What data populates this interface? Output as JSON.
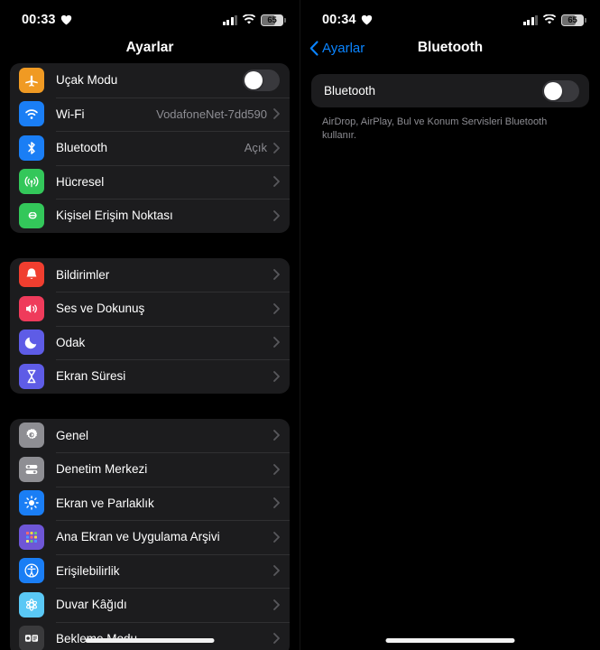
{
  "left_panel": {
    "status_bar": {
      "time": "00:33",
      "heart_icon": "heart-icon",
      "signal_icon": "cellular-signal-icon",
      "wifi_icon": "wifi-icon",
      "battery_percent": "65"
    },
    "nav": {
      "title": "Ayarlar"
    },
    "groups": [
      {
        "rows": [
          {
            "label": "Uçak Modu",
            "value": "",
            "icon": "airplane-icon",
            "icon_color": "#f09a23",
            "control": "toggle",
            "toggle_on": false
          },
          {
            "label": "Wi-Fi",
            "value": "VodafoneNet-7dd590",
            "icon": "wifi-icon",
            "icon_color": "#1a7ef5",
            "control": "chevron"
          },
          {
            "label": "Bluetooth",
            "value": "Açık",
            "icon": "bluetooth-icon",
            "icon_color": "#1a7ef5",
            "control": "chevron"
          },
          {
            "label": "Hücresel",
            "value": "",
            "icon": "cellular-icon",
            "icon_color": "#33c75a",
            "control": "chevron"
          },
          {
            "label": "Kişisel Erişim Noktası",
            "value": "",
            "icon": "hotspot-icon",
            "icon_color": "#33c75a",
            "control": "chevron"
          }
        ]
      },
      {
        "rows": [
          {
            "label": "Bildirimler",
            "value": "",
            "icon": "bell-icon",
            "icon_color": "#f03e2f",
            "control": "chevron"
          },
          {
            "label": "Ses ve Dokunuş",
            "value": "",
            "icon": "speaker-icon",
            "icon_color": "#ef3b5b",
            "control": "chevron"
          },
          {
            "label": "Odak",
            "value": "",
            "icon": "moon-icon",
            "icon_color": "#5e5ce6",
            "control": "chevron"
          },
          {
            "label": "Ekran Süresi",
            "value": "",
            "icon": "hourglass-icon",
            "icon_color": "#5e5ce6",
            "control": "chevron"
          }
        ]
      },
      {
        "rows": [
          {
            "label": "Genel",
            "value": "",
            "icon": "gear-icon",
            "icon_color": "#8e8e93",
            "control": "chevron"
          },
          {
            "label": "Denetim Merkezi",
            "value": "",
            "icon": "control-center-icon",
            "icon_color": "#8e8e93",
            "control": "chevron"
          },
          {
            "label": "Ekran ve Parlaklık",
            "value": "",
            "icon": "brightness-icon",
            "icon_color": "#1a7ef5",
            "control": "chevron"
          },
          {
            "label": "Ana Ekran ve Uygulama Arşivi",
            "value": "",
            "icon": "app-grid-icon",
            "icon_color": "#6e56d6",
            "control": "chevron"
          },
          {
            "label": "Erişilebilirlik",
            "value": "",
            "icon": "accessibility-icon",
            "icon_color": "#1a7ef5",
            "control": "chevron"
          },
          {
            "label": "Duvar Kâğıdı",
            "value": "",
            "icon": "wallpaper-icon",
            "icon_color": "#5ac8f5",
            "control": "chevron"
          },
          {
            "label": "Bekleme Modu",
            "value": "",
            "icon": "standby-icon",
            "icon_color": "#3a3a3c",
            "control": "chevron"
          }
        ]
      }
    ]
  },
  "right_panel": {
    "status_bar": {
      "time": "00:34",
      "heart_icon": "heart-icon",
      "signal_icon": "cellular-signal-icon",
      "wifi_icon": "wifi-icon",
      "battery_percent": "65"
    },
    "nav": {
      "back_label": "Ayarlar",
      "title": "Bluetooth"
    },
    "bluetooth": {
      "label": "Bluetooth",
      "toggle_on": false,
      "footer": "AirDrop, AirPlay, Bul ve Konum Servisleri Bluetooth kullanır."
    }
  },
  "colors": {
    "accent_blue": "#0a84ff",
    "card_bg": "#1c1c1e",
    "page_bg": "#000000",
    "separator": "#303032",
    "secondary_text": "#8d8d93"
  }
}
